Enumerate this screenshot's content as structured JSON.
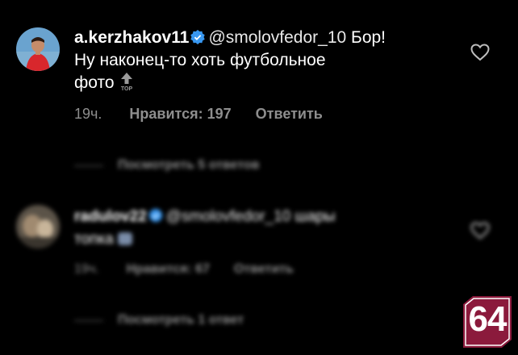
{
  "comments": [
    {
      "username": "a.kerzhakov11",
      "mention": "@smolovfedor_10",
      "text_line1": "Бор!",
      "text_line2": "Ну наконец-то хоть футбольное",
      "text_line3": "фото",
      "emoji": "top-arrow-emoji",
      "time": "19ч.",
      "likes": "Нравится: 197",
      "reply": "Ответить",
      "view_replies": "Посмотреть 5 ответов"
    },
    {
      "username": "radulov22",
      "mention": "@smolovfedor_10",
      "text_line1": "шары",
      "text_line2": "топка",
      "emoji": "sparkle-emoji",
      "time": "19ч.",
      "likes": "Нравится: 67",
      "reply": "Ответить",
      "view_replies": "Посмотреть 1 ответ"
    }
  ],
  "watermark": {
    "text": "64",
    "color": "#8b1a3c"
  },
  "colors": {
    "verified": "#3897f0",
    "secondary_text": "#8e8e8e"
  }
}
